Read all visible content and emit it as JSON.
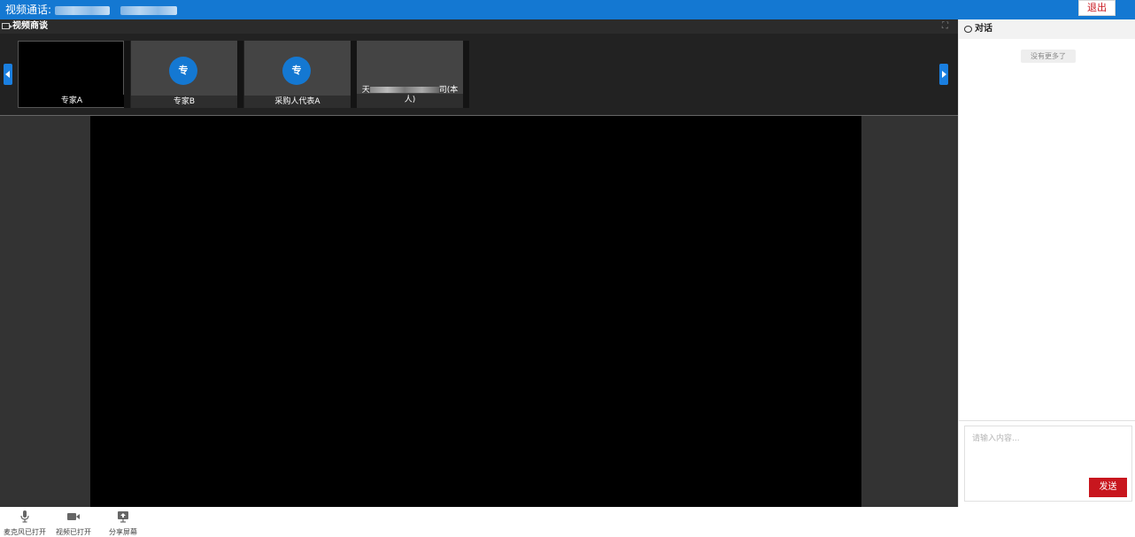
{
  "header": {
    "title": "视频通话:",
    "exit_label": "退出",
    "brand_color": "#1478d2"
  },
  "video_panel": {
    "title": "视频商谈",
    "participants": [
      {
        "name": "专家A",
        "avatar": ""
      },
      {
        "name": "专家B",
        "avatar": "专"
      },
      {
        "name": "采购人代表A",
        "avatar": "专"
      },
      {
        "name_prefix": "天",
        "name_suffix": "司(本",
        "name_line2": "人)"
      }
    ]
  },
  "chat": {
    "title": "对话",
    "no_more": "没有更多了",
    "input_placeholder": "请输入内容...",
    "send_label": "发送",
    "send_color": "#c8161e"
  },
  "controls": {
    "mic_label": "麦克风已打开",
    "camera_label": "视频已打开",
    "share_label": "分享屏幕",
    "icons": [
      "microphone-icon",
      "video-camera-icon",
      "screen-share-icon"
    ]
  }
}
